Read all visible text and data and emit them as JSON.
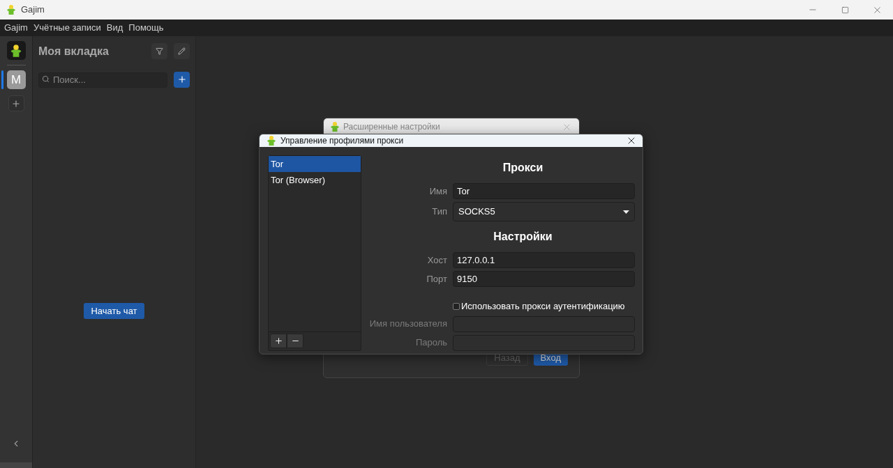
{
  "window": {
    "title": "Gajim"
  },
  "menu": [
    "Gajim",
    "Учётные записи",
    "Вид",
    "Помощь"
  ],
  "rail": {
    "accounts": [
      {
        "initial": "M",
        "selected": true
      }
    ]
  },
  "sidebar": {
    "title": "Моя вкладка",
    "search": {
      "placeholder": "Поиск..."
    },
    "start_chat": "Начать чат"
  },
  "back_dialog": {
    "title": "Расширенные настройки",
    "buttons": [
      {
        "label": "Назад",
        "disabled": true,
        "primary": false
      },
      {
        "label": "Вход",
        "disabled": false,
        "primary": true
      }
    ]
  },
  "proxy_dialog": {
    "title": "Управление профилями прокси",
    "profiles": [
      {
        "name": "Tor",
        "selected": true
      },
      {
        "name": "Tor (Browser)",
        "selected": false
      }
    ],
    "rows": [
      {
        "kind": "heading",
        "text": "Прокси"
      },
      {
        "kind": "field",
        "label": "Имя",
        "value": "Tor"
      },
      {
        "kind": "select",
        "label": "Тип",
        "value": "SOCKS5"
      },
      {
        "kind": "heading",
        "text": "Настройки"
      },
      {
        "kind": "field",
        "label": "Хост",
        "value": "127.0.0.1"
      },
      {
        "kind": "field",
        "label": "Порт",
        "value": "9150"
      },
      {
        "kind": "checkbox",
        "text": "Использовать прокси аутентификацию",
        "checked": false
      },
      {
        "kind": "field",
        "label": "Имя пользователя",
        "value": "",
        "disabled": true
      },
      {
        "kind": "field",
        "label": "Пароль",
        "value": "",
        "disabled": true
      }
    ]
  }
}
